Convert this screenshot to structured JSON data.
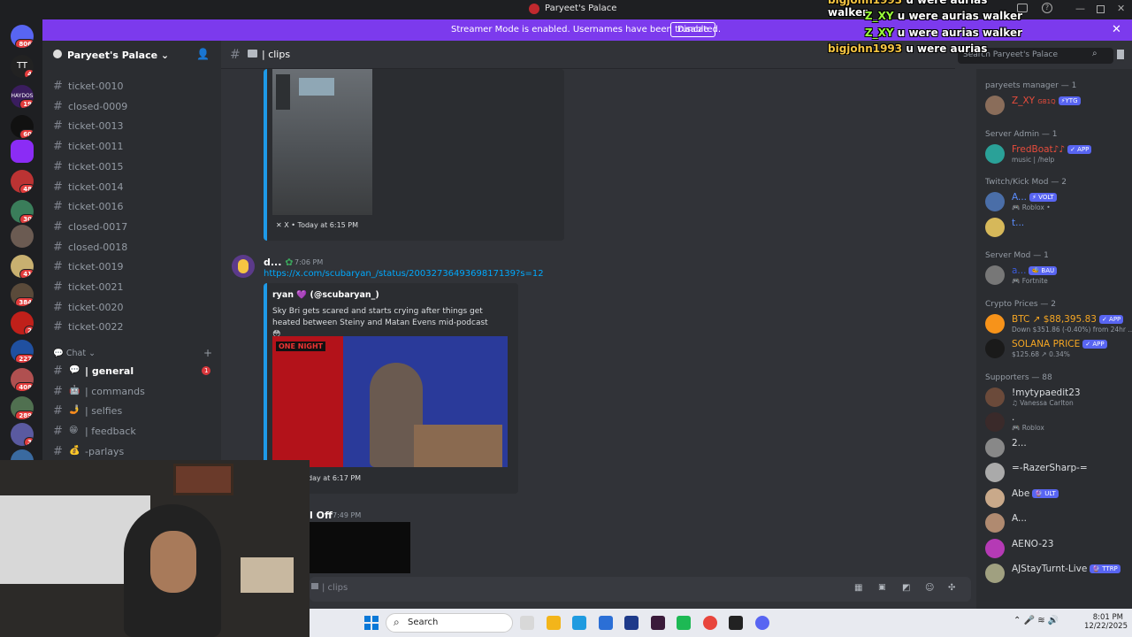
{
  "window": {
    "title": "Paryeet's Palace"
  },
  "banner": {
    "text": "Streamer Mode is enabled. Usernames have been truncated.",
    "disable_label": "Disable",
    "color": "#7c3aed"
  },
  "overlay_chat": [
    {
      "user": "bigjohn1993",
      "msg": "u were aurias walker",
      "color": "#f5c542"
    },
    {
      "user": "Z_XY",
      "msg": "u were aurias walker",
      "color": "#9aff3a"
    },
    {
      "user": "Z_XY",
      "msg": "u were aurias walker",
      "color": "#9aff3a"
    },
    {
      "user": "bigjohn1993",
      "msg": "u were aurias walker",
      "color": "#f5c542"
    }
  ],
  "guild_rail": {
    "badges": [
      "806",
      "4",
      "19",
      "60",
      "48",
      "30",
      "41",
      "384",
      "2",
      "227",
      "408",
      "289",
      "3"
    ],
    "labels": [
      "TT",
      "HAYDOS"
    ]
  },
  "server": {
    "name": "Paryeet's Palace"
  },
  "channels": [
    {
      "name": "ticket-0010"
    },
    {
      "name": "closed-0009"
    },
    {
      "name": "ticket-0013"
    },
    {
      "name": "ticket-0011"
    },
    {
      "name": "ticket-0015"
    },
    {
      "name": "ticket-0014"
    },
    {
      "name": "ticket-0016"
    },
    {
      "name": "closed-0017"
    },
    {
      "name": "closed-0018"
    },
    {
      "name": "ticket-0019"
    },
    {
      "name": "ticket-0021"
    },
    {
      "name": "ticket-0020"
    },
    {
      "name": "ticket-0022"
    }
  ],
  "chat_category": {
    "label": "Chat"
  },
  "chat_channels": [
    {
      "emoji": "💬",
      "name": "| general",
      "badge": "1"
    },
    {
      "emoji": "🤖",
      "name": "| commands"
    },
    {
      "emoji": "🤳",
      "name": "| selfies"
    },
    {
      "emoji": "😁",
      "name": "| feedback"
    },
    {
      "emoji": "💰",
      "name": "-parlays"
    }
  ],
  "header": {
    "channel": "| clips",
    "search_placeholder": "Search Paryeet's Palace"
  },
  "messages": {
    "embed1_footer": "X • Today at 6:15 PM",
    "msg2": {
      "author": "d...",
      "time": "7:06 PM",
      "link": "https://x.com/scubaryan_/status/2003273649369817139?s=12",
      "embed_author": "ryan",
      "embed_handle": "(@scubaryan_)",
      "embed_text": "Sky Bri gets scared and starts crying after things get heated between Steiny and Matan Evens mid-podcast 😳",
      "video_label": "ONE NIGHT",
      "footer": "day at 6:17 PM"
    },
    "msg3": {
      "author": "l Off",
      "time": "7:49 PM"
    }
  },
  "composer": {
    "placeholder": "| clips"
  },
  "members": {
    "sections": [
      {
        "title": "paryeets manager — 1",
        "items": [
          {
            "name": "Z_XY",
            "extra": "GB1Q",
            "tag": "⚡YTG",
            "color": "#e74c3c",
            "av": "#8a6d5a"
          }
        ]
      },
      {
        "title": "Server Admin — 1",
        "items": [
          {
            "name": "FredBoat♪♪",
            "tag": "✓ APP",
            "sub": "music | /help",
            "color": "#e74c3c",
            "av": "#2aa198"
          }
        ]
      },
      {
        "title": "Twitch/Kick Mod — 2",
        "items": [
          {
            "name": "A...",
            "tag": "⚡ VOLT",
            "sub": "🎮 Roblox •",
            "color": "#5b8dff",
            "av": "#4a6ea8"
          },
          {
            "name": "t...",
            "color": "#5b8dff",
            "av": "#d6b85a"
          }
        ]
      },
      {
        "title": "Server Mod — 1",
        "items": [
          {
            "name": "a...",
            "tag": "🐝 BAU",
            "sub": "🎮 Fortnite",
            "color": "#3b5bdb",
            "av": "#777"
          }
        ]
      },
      {
        "title": "Crypto Prices — 2",
        "items": [
          {
            "name": "BTC ↗ $88,395.83",
            "tag": "✓ APP",
            "sub": "Down $351.86 (-0.40%) from 24hr ...",
            "color": "#f5a623",
            "av": "#f7931a"
          },
          {
            "name": "SOLANA PRICE",
            "tag": "✓ APP",
            "sub": "$125.68 ↗ 0.34%",
            "color": "#f5a623",
            "av": "#1a1a1a"
          }
        ]
      },
      {
        "title": "Supporters — 88",
        "items": [
          {
            "name": "!mytypaedit23",
            "sub": "♫ Vanessa Carlton",
            "color": "#dbdee1",
            "av": "#6b4a3a"
          },
          {
            "name": ".",
            "sub": "🎮 Roblox",
            "color": "#dbdee1",
            "av": "#3a2a2a"
          },
          {
            "name": "2...",
            "color": "#dbdee1",
            "av": "#888"
          },
          {
            "name": "=-RazerSharp-=",
            "color": "#dbdee1",
            "av": "#aaa"
          },
          {
            "name": "Abe",
            "tag": "🔮 ULT",
            "color": "#dbdee1",
            "av": "#c9a98a"
          },
          {
            "name": "A...",
            "color": "#dbdee1",
            "av": "#b08a70"
          },
          {
            "name": "AENO-23",
            "color": "#dbdee1",
            "av": "#b53ab5"
          },
          {
            "name": "AJStayTurnt-Live",
            "tag": "🔮 TTRP",
            "color": "#dbdee1",
            "av": "#a0a080"
          }
        ]
      }
    ]
  },
  "taskbar": {
    "search_label": "Search",
    "time": "8:01 PM",
    "date": "12/22/2025",
    "app_colors": [
      "#d8d8d8",
      "#f3b51a",
      "#1f9be0",
      "#2b6fd6",
      "#1e3a8a",
      "#3a1a3a",
      "#1db954",
      "#e8453c",
      "#222",
      "#5865f2"
    ]
  }
}
